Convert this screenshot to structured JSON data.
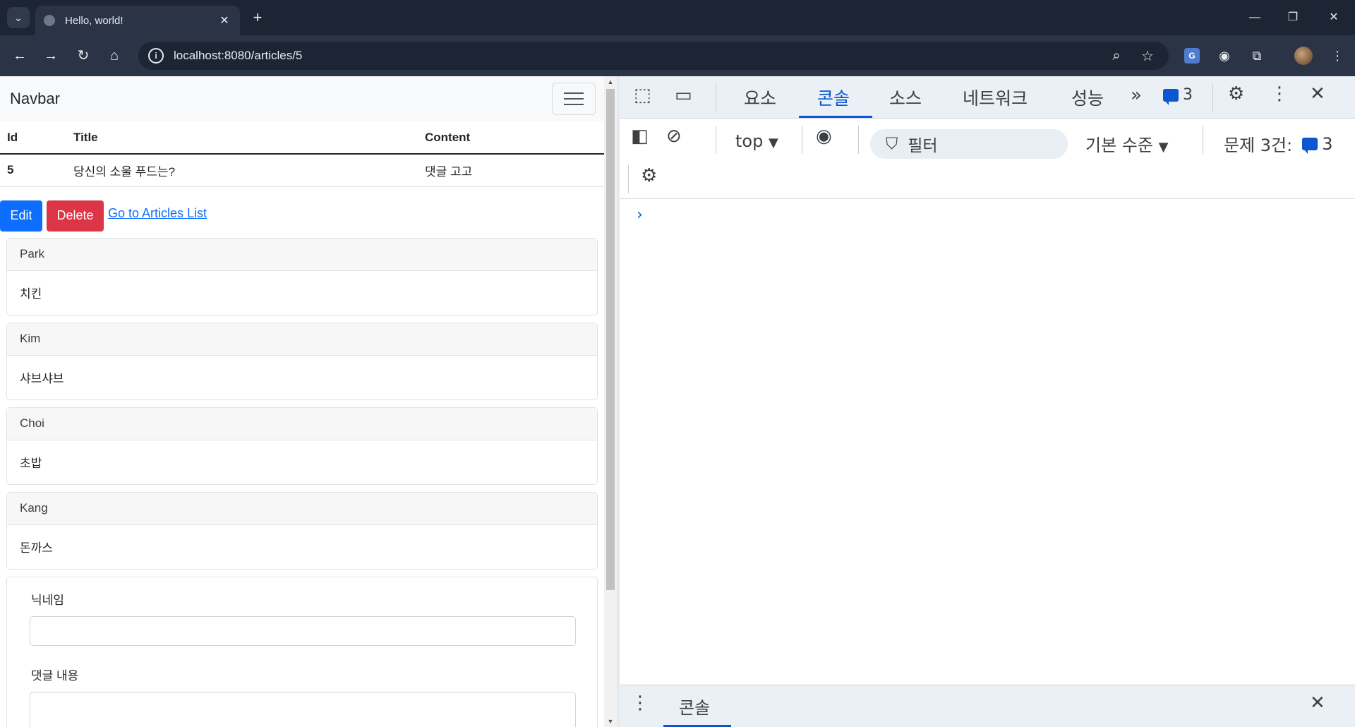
{
  "browser": {
    "tab_title": "Hello, world!",
    "tab_close": "✕",
    "new_tab": "+",
    "url": "localhost:8080/articles/5",
    "window_controls": {
      "minimize": "—",
      "restore": "❐",
      "close": "✕"
    },
    "nav": {
      "back": "←",
      "forward": "→",
      "reload": "↻",
      "home": "⌂"
    }
  },
  "page": {
    "navbar_brand": "Navbar",
    "table": {
      "headers": [
        "Id",
        "Title",
        "Content"
      ],
      "rows": [
        [
          "5",
          "당신의 소울 푸드는?",
          "댓글 고고"
        ]
      ]
    },
    "buttons": {
      "edit": "Edit",
      "delete": "Delete",
      "list_link": "Go to Articles List"
    },
    "comments": [
      {
        "nickname": "Park",
        "body": "치킨"
      },
      {
        "nickname": "Kim",
        "body": "샤브샤브"
      },
      {
        "nickname": "Choi",
        "body": "초밥"
      },
      {
        "nickname": "Kang",
        "body": "돈까스"
      }
    ],
    "form": {
      "nickname_label": "닉네임",
      "body_label": "댓글 내용"
    }
  },
  "devtools": {
    "tabs": [
      "요소",
      "콘솔",
      "소스",
      "네트워크",
      "성능"
    ],
    "active_tab": "콘솔",
    "issue_count": "3",
    "context": "top",
    "filter_placeholder": "필터",
    "level": "기본 수준",
    "issues_label": "문제 3건:",
    "issues_count": "3",
    "prompt": "›",
    "drawer_tab": "콘솔"
  },
  "colors": {
    "primary": "#0d6efd",
    "danger": "#dc3545",
    "devtools_accent": "#0b57d0"
  }
}
